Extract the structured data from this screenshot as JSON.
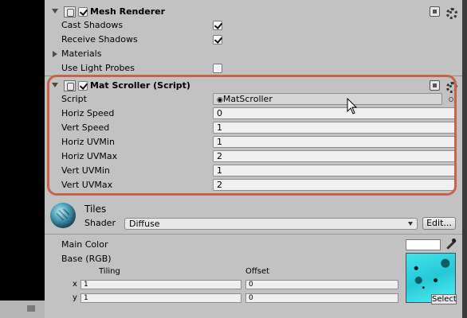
{
  "mesh_renderer": {
    "title": "Mesh Renderer",
    "enabled": true,
    "cast_shadows_label": "Cast Shadows",
    "cast_shadows": true,
    "receive_shadows_label": "Receive Shadows",
    "receive_shadows": true,
    "materials_label": "Materials",
    "use_light_probes_label": "Use Light Probes",
    "use_light_probes": false
  },
  "mat_scroller": {
    "title": "Mat Scroller (Script)",
    "enabled": true,
    "script_label": "Script",
    "script_value": "MatScroller",
    "fields": [
      {
        "label": "Horiz Speed",
        "value": "0"
      },
      {
        "label": "Vert Speed",
        "value": "1"
      },
      {
        "label": "Horiz UVMin",
        "value": "1"
      },
      {
        "label": "Horiz UVMax",
        "value": "2"
      },
      {
        "label": "Vert UVMin",
        "value": "1"
      },
      {
        "label": "Vert UVMax",
        "value": "2"
      }
    ]
  },
  "material": {
    "name": "Tiles",
    "shader_label": "Shader",
    "shader_value": "Diffuse",
    "edit_button": "Edit...",
    "main_color_label": "Main Color",
    "main_color": "#ffffff",
    "base_label": "Base (RGB)",
    "tiling_label": "Tiling",
    "offset_label": "Offset",
    "x_label": "x",
    "y_label": "y",
    "tiling_x": "1",
    "tiling_y": "1",
    "offset_x": "0",
    "offset_y": "0",
    "select_button": "Select"
  },
  "colors": {
    "panel": "#c2c2c2",
    "highlight": "#c9624a",
    "texture": "#25c9d7"
  }
}
